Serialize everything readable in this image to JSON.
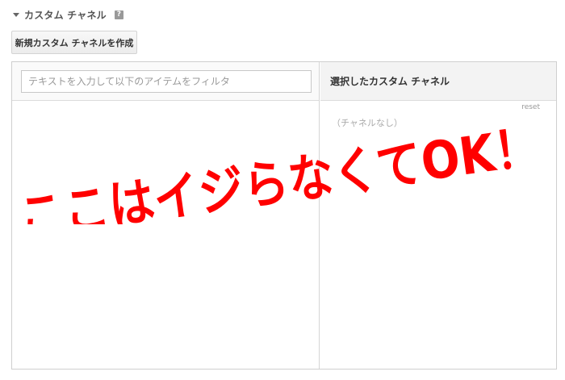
{
  "section": {
    "title": "カスタム チャネル",
    "help_icon": "?"
  },
  "toolbar": {
    "create_label": "新規カスタム チャネルを作成"
  },
  "left_pane": {
    "filter_placeholder": "テキストを入力して以下のアイテムをフィルタ"
  },
  "right_pane": {
    "title": "選択したカスタム チャネル",
    "reset_label": "reset",
    "empty_text": "（チャネルなし）"
  },
  "annotation": {
    "text": "ここはイジらなくてOK！",
    "color": "#ff0000"
  },
  "icons": {
    "caret": "caret-down-icon",
    "help": "help-icon"
  }
}
